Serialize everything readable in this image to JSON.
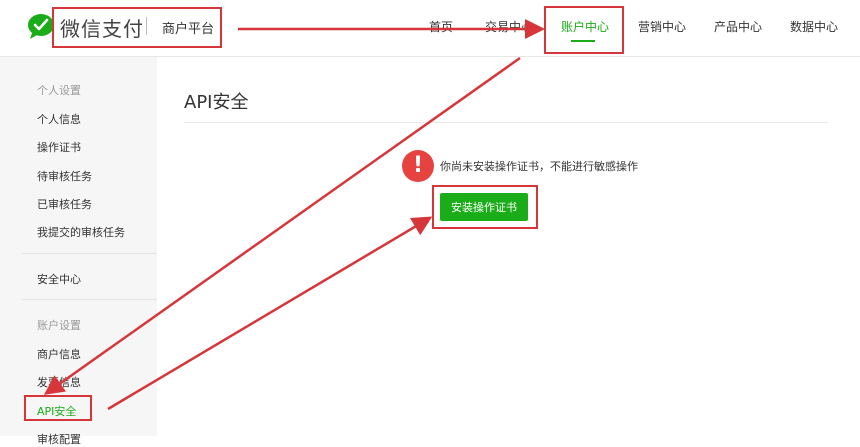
{
  "header": {
    "brand": "微信支付",
    "platform": "商户平台",
    "nav": [
      {
        "label": "首页"
      },
      {
        "label": "交易中心"
      },
      {
        "label": "账户中心",
        "active": true
      },
      {
        "label": "营销中心"
      },
      {
        "label": "产品中心"
      },
      {
        "label": "数据中心"
      }
    ]
  },
  "sidebar": {
    "group1_title": "个人设置",
    "group1_items": [
      "个人信息",
      "操作证书",
      "待审核任务",
      "已审核任务",
      "我提交的审核任务"
    ],
    "security_center": "安全中心",
    "group2_title": "账户设置",
    "group2_items": [
      "商户信息",
      "发票信息",
      "API安全",
      "审核配置"
    ]
  },
  "main": {
    "title": "API安全",
    "warning": "你尚未安装操作证书，不能进行敏感操作",
    "install_button": "安装操作证书"
  },
  "colors": {
    "accent": "#1aad19",
    "warning": "#e64340",
    "annotation": "#d6353a"
  }
}
